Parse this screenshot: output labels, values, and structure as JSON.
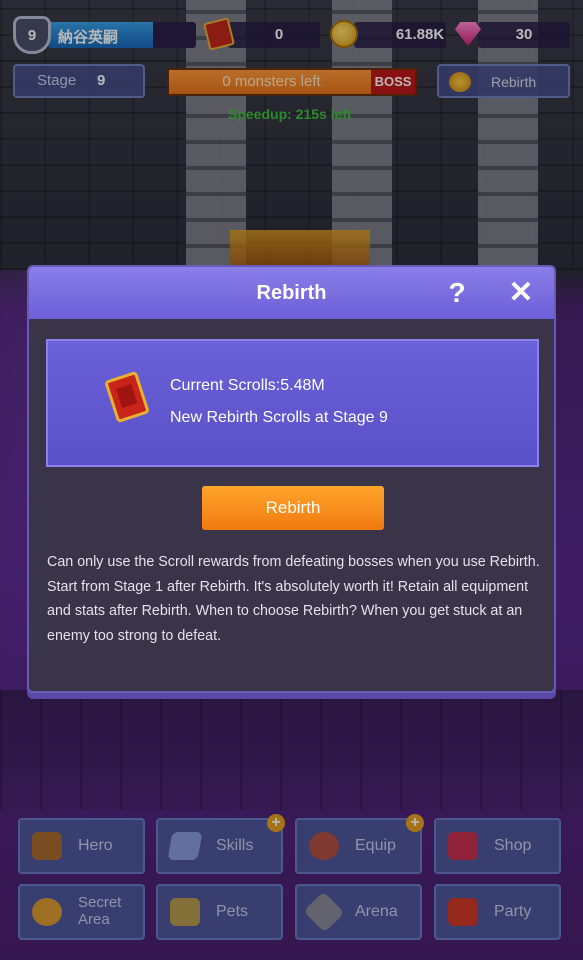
{
  "hud": {
    "level": "9",
    "player_name": "納谷英嗣",
    "scrolls_count": "0",
    "gold": "61.88K",
    "gems": "30",
    "stage_label": "Stage",
    "stage_number": "9",
    "monsters_left": "0 monsters left",
    "boss_label": "BOSS",
    "rebirth_label": "Rebirth",
    "speedup": "Speedup: 215s left"
  },
  "modal": {
    "title": "Rebirth",
    "help": "?",
    "close": "✕",
    "current_scrolls": "Current Scrolls:5.48M",
    "new_scrolls": "New Rebirth Scrolls at Stage 9",
    "button_label": "Rebirth",
    "description": "Can only use the Scroll rewards from defeating bosses when you use Rebirth. Start from Stage 1 after Rebirth. It's absolutely worth it! Retain all equipment and stats after Rebirth. When to choose Rebirth? When you get stuck at an enemy too strong to defeat."
  },
  "menu": {
    "hero": "Hero",
    "skills": "Skills",
    "equip": "Equip",
    "shop": "Shop",
    "secret_area": "Secret Area",
    "pets": "Pets",
    "arena": "Arena",
    "party": "Party",
    "plus": "+"
  }
}
